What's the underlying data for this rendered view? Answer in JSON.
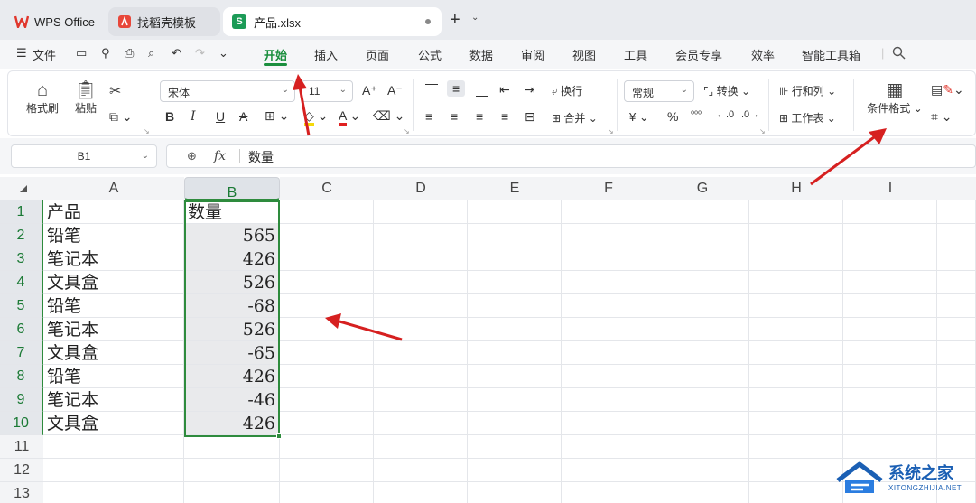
{
  "tabs": {
    "wps_label": "WPS Office",
    "template_label": "找稻壳模板",
    "file_label": "产品.xlsx",
    "file_badge": "S"
  },
  "menu": {
    "file": "文件",
    "items": [
      "开始",
      "插入",
      "页面",
      "公式",
      "数据",
      "审阅",
      "视图",
      "工具",
      "会员专享",
      "效率",
      "智能工具箱"
    ],
    "active": "开始"
  },
  "ribbon": {
    "format_painter": "格式刷",
    "paste": "粘贴",
    "font_name": "宋体",
    "font_size": "11",
    "wrap": "换行",
    "merge": "合并",
    "number_format": "常规",
    "convert": "转换",
    "row_col": "行和列",
    "worksheet": "工作表",
    "cond_format": "条件格式",
    "percent": "%",
    "currency": "¥",
    "bold": "B",
    "italic": "I",
    "underline": "U"
  },
  "formula_bar": {
    "name_box": "B1",
    "fx_label": "fx",
    "content": "数量"
  },
  "grid": {
    "columns": [
      "A",
      "B",
      "C",
      "D",
      "E",
      "F",
      "G",
      "H",
      "I"
    ],
    "rows": [
      "1",
      "2",
      "3",
      "4",
      "5",
      "6",
      "7",
      "8",
      "9",
      "10",
      "11",
      "12",
      "13"
    ],
    "colA": [
      "产品",
      "铅笔",
      "笔记本",
      "文具盒",
      "铅笔",
      "笔记本",
      "文具盒",
      "铅笔",
      "笔记本",
      "文具盒"
    ],
    "colB": [
      "数量",
      "565",
      "426",
      "526",
      "-68",
      "526",
      "-65",
      "426",
      "-46",
      "426"
    ]
  },
  "watermark": {
    "brand": "系统之家",
    "domain": "XITONGZHIJIA.NET"
  },
  "colors": {
    "accent": "#1b8f3e",
    "selection": "#2e8b3d",
    "arrow": "#d62020"
  }
}
